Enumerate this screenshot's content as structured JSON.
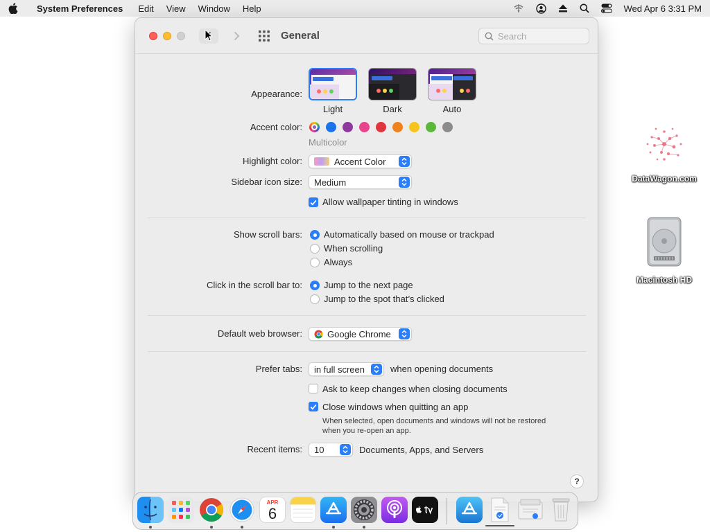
{
  "menubar": {
    "app_name": "System Preferences",
    "items": [
      "Edit",
      "View",
      "Window",
      "Help"
    ],
    "clock": "Wed Apr 6  3:31 PM"
  },
  "window": {
    "title": "General",
    "search_placeholder": "Search"
  },
  "appearance": {
    "label": "Appearance:",
    "options": [
      "Light",
      "Dark",
      "Auto"
    ],
    "selected": "Light"
  },
  "accent_color": {
    "label": "Accent color:",
    "selected_name": "Multicolor",
    "swatches": [
      "#9b59b6",
      "#1a73e8",
      "#8e3a9d",
      "#e8448c",
      "#e0343f",
      "#f0821e",
      "#f6c51d",
      "#5bb83b",
      "#8c8c8c"
    ]
  },
  "highlight_color": {
    "label": "Highlight color:",
    "value": "Accent Color"
  },
  "sidebar_icon_size": {
    "label": "Sidebar icon size:",
    "value": "Medium"
  },
  "wallpaper_tinting": {
    "label": "Allow wallpaper tinting in windows",
    "checked": true
  },
  "scroll_bars": {
    "label": "Show scroll bars:",
    "options": [
      "Automatically based on mouse or trackpad",
      "When scrolling",
      "Always"
    ],
    "selected_index": 0
  },
  "click_scroll_bar": {
    "label": "Click in the scroll bar to:",
    "options": [
      "Jump to the next page",
      "Jump to the spot that’s clicked"
    ],
    "selected_index": 0
  },
  "default_browser": {
    "label": "Default web browser:",
    "value": "Google Chrome"
  },
  "prefer_tabs": {
    "label": "Prefer tabs:",
    "value": "in full screen",
    "suffix": "when opening documents"
  },
  "ask_keep_changes": {
    "label": "Ask to keep changes when closing documents",
    "checked": false
  },
  "close_windows": {
    "label": "Close windows when quitting an app",
    "checked": true,
    "note_line1": "When selected, open documents and windows will not be restored",
    "note_line2": "when you re-open an app."
  },
  "recent_items": {
    "label": "Recent items:",
    "value": "10",
    "suffix": "Documents, Apps, and Servers"
  },
  "help": "?",
  "desktop": {
    "icons": [
      "DataWagon.com",
      "Macintosh HD"
    ]
  },
  "dock": {
    "calendar_month": "APR",
    "calendar_day": "6"
  },
  "colors": {
    "accent": "#2a7ef7",
    "close": "#fe5f57",
    "minimize": "#febc2e",
    "zoom_disabled": "#d0d0d0"
  }
}
